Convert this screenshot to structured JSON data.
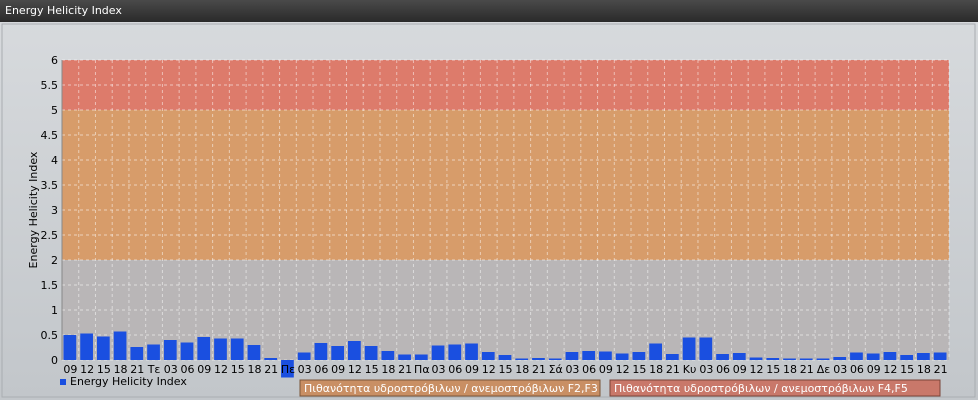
{
  "window": {
    "title": "Energy Helicity Index"
  },
  "colors": {
    "bar": "#1a4fe0",
    "band_low": "#b9b6b7",
    "band_mid": "#d79c6a",
    "band_high": "#dd7b6b"
  },
  "chart_data": {
    "type": "bar",
    "ylabel": "Energy Helicity Index",
    "ylim": [
      -0.4,
      6
    ],
    "yticks": [
      "0",
      "0.5",
      "1",
      "1.5",
      "2",
      "2.5",
      "3",
      "3.5",
      "4",
      "4.5",
      "5",
      "5.5",
      "6"
    ],
    "categories": [
      "09",
      "12",
      "15",
      "18",
      "21",
      "Τε",
      "03",
      "06",
      "09",
      "12",
      "15",
      "18",
      "21",
      "Πε",
      "03",
      "06",
      "09",
      "12",
      "15",
      "18",
      "21",
      "Πα",
      "03",
      "06",
      "09",
      "12",
      "15",
      "18",
      "21",
      "Σά",
      "03",
      "06",
      "09",
      "12",
      "15",
      "18",
      "21",
      "Κυ",
      "03",
      "06",
      "09",
      "12",
      "15",
      "18",
      "21",
      "Δε",
      "03",
      "06",
      "09",
      "12",
      "15",
      "18",
      "21"
    ],
    "series": [
      {
        "name": "Energy Helicity Index",
        "values": [
          0.5,
          0.53,
          0.47,
          0.57,
          0.26,
          0.31,
          0.4,
          0.35,
          0.46,
          0.43,
          0.43,
          0.3,
          0.04,
          -0.35,
          0.15,
          0.34,
          0.28,
          0.38,
          0.28,
          0.18,
          0.11,
          0.11,
          0.29,
          0.31,
          0.33,
          0.16,
          0.1,
          0.03,
          0.04,
          0.03,
          0.16,
          0.18,
          0.17,
          0.13,
          0.16,
          0.33,
          0.12,
          0.45,
          0.45,
          0.12,
          0.14,
          0.05,
          0.04,
          0.03,
          0.03,
          0.03,
          0.06,
          0.15,
          0.13,
          0.16,
          0.1,
          0.14,
          0.15
        ]
      }
    ],
    "bands": [
      {
        "from": 2,
        "to": 5,
        "label": "Πιθανότητα υδροστρόβιλων / ανεμοστρόβιλων F2,F3"
      },
      {
        "from": 5,
        "to": 6,
        "label": "Πιθανότητα υδροστρόβιλων / ανεμοστρόβιλων F4,F5"
      }
    ],
    "grid": true,
    "legend_position": "bottom-left"
  }
}
